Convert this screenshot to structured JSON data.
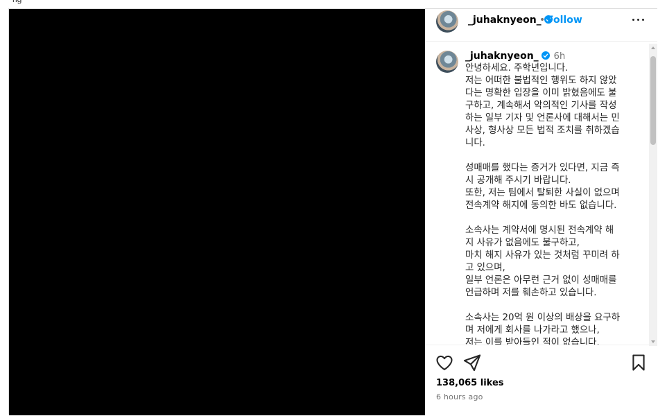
{
  "browser": {
    "partial_title": "ng"
  },
  "post": {
    "username": "_juhaknyeon_",
    "follow_label": "Follow",
    "separator": "•",
    "time_ago": "6h",
    "caption_paragraphs": [
      [
        "안녕하세요. 주학년입니다.",
        "저는 어떠한 불법적인 행위도 하지 않았",
        "다는 명확한 입장을 이미 밝혔음에도 불",
        "구하고, 계속해서 악의적인 기사를 작성",
        "하는 일부 기자 및 언론사에 대해서는 민",
        "사상, 형사상 모든 법적 조치를 취하겠습",
        "니다."
      ],
      [
        "성매매를 했다는 증거가 있다면, 지금 즉",
        "시 공개해 주시기 바랍니다.",
        "또한, 저는 팀에서 탈퇴한 사실이 없으며",
        "전속계약 해지에 동의한 바도 없습니다."
      ],
      [
        "소속사는 계약서에 명시된 전속계약 해",
        "지 사유가 없음에도 불구하고,",
        "마치 해지 사유가 있는 것처럼 꾸미려 하",
        "고 있으며,",
        "일부 언론은 아무런 근거 없이 성매매를",
        "언급하며 저를 훼손하고 있습니다."
      ],
      [
        "소속사는 20억 원 이상의 배상을 요구하",
        "며 저에게 회사를 나가라고 했으나,",
        "저는 이를 받아들인 적이 없습니다."
      ]
    ],
    "likes": "138,065 likes",
    "posted_time": "6 hours ago"
  },
  "icons": {
    "like": "heart-icon",
    "share": "send-icon",
    "save": "bookmark-icon",
    "more": "more-options-icon",
    "verified": "verified-badge-icon"
  },
  "colors": {
    "accent": "#0095f6",
    "muted": "#737373",
    "media_bg": "#000000"
  }
}
